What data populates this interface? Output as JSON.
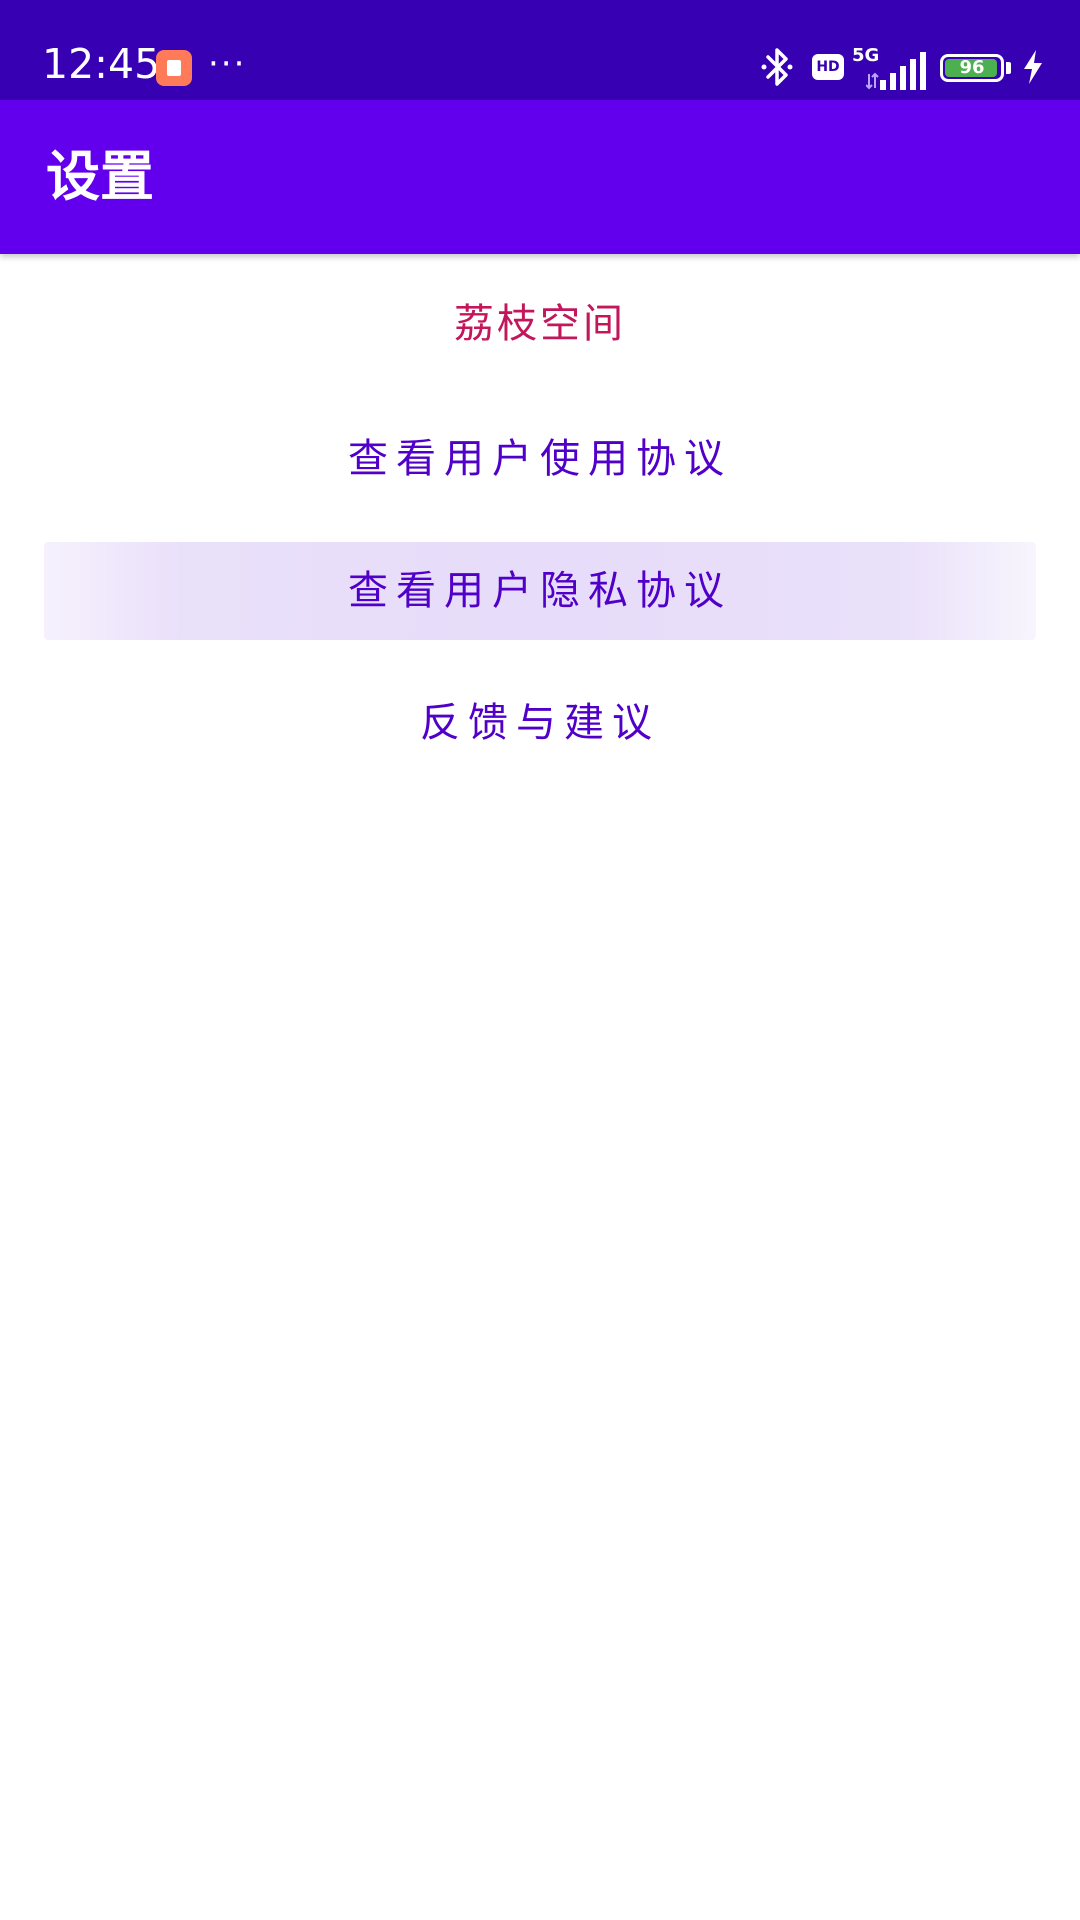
{
  "status_bar": {
    "time": "12:45",
    "more": "···",
    "hd": "HD",
    "network": "5G",
    "battery_level": "96",
    "battery_fraction": 0.96,
    "colors": {
      "background": "#3700b3",
      "battery_fill": "#4caf50",
      "app_badge": "#ff7a59"
    },
    "icons": [
      "app-notification-icon",
      "bluetooth-icon",
      "hd-voice-icon",
      "signal-icon",
      "battery-icon",
      "charging-icon"
    ]
  },
  "toolbar": {
    "title": "设置",
    "background": "#6200ee"
  },
  "menu": {
    "header": "荔枝空间",
    "header_color": "#c2185b",
    "items": [
      {
        "label": "查看用户使用协议"
      },
      {
        "label": "查看用户隐私协议",
        "pressed": true
      },
      {
        "label": "反馈与建议"
      }
    ],
    "item_color": "#5000c8"
  }
}
